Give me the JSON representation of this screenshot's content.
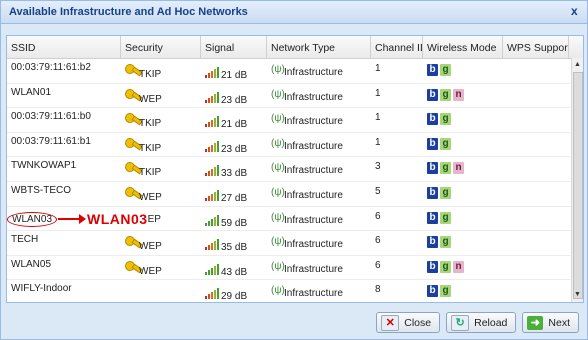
{
  "window": {
    "title": "Available Infrastructure and Ad Hoc Networks",
    "close_glyph": "x"
  },
  "columns": [
    "SSID",
    "Security",
    "Signal",
    "Network Type",
    "Channel ID",
    "Wireless Mode",
    "WPS Support"
  ],
  "rows": [
    {
      "ssid": "00:03:79:11:61:b2",
      "security": "TKIP",
      "signal": "21 dB",
      "type": "Infrastructure",
      "channel": "1",
      "modes": [
        "b",
        "g"
      ]
    },
    {
      "ssid": "WLAN01",
      "security": "WEP",
      "signal": "23 dB",
      "type": "Infrastructure",
      "channel": "1",
      "modes": [
        "b",
        "g",
        "n"
      ]
    },
    {
      "ssid": "00:03:79:11:61:b0",
      "security": "TKIP",
      "signal": "21 dB",
      "type": "Infrastructure",
      "channel": "1",
      "modes": [
        "b",
        "g"
      ]
    },
    {
      "ssid": "00:03:79:11:61:b1",
      "security": "TKIP",
      "signal": "23 dB",
      "type": "Infrastructure",
      "channel": "1",
      "modes": [
        "b",
        "g"
      ]
    },
    {
      "ssid": "TWNKOWAP1",
      "security": "TKIP",
      "signal": "33 dB",
      "type": "Infrastructure",
      "channel": "3",
      "modes": [
        "b",
        "g",
        "n"
      ]
    },
    {
      "ssid": "WBTS-TECO",
      "security": "WEP",
      "signal": "27 dB",
      "type": "Infrastructure",
      "channel": "5",
      "modes": [
        "b",
        "g"
      ]
    },
    {
      "ssid": "WLAN03",
      "security": "WEP",
      "signal": "59 dB",
      "type": "Infrastructure",
      "channel": "6",
      "modes": [
        "b",
        "g"
      ]
    },
    {
      "ssid": "TECH",
      "security": "WEP",
      "signal": "35 dB",
      "type": "Infrastructure",
      "channel": "6",
      "modes": [
        "b",
        "g"
      ]
    },
    {
      "ssid": "WLAN05",
      "security": "WEP",
      "signal": "43 dB",
      "type": "Infrastructure",
      "channel": "6",
      "modes": [
        "b",
        "g",
        "n"
      ]
    },
    {
      "ssid": "WIFLY-Indoor",
      "security": "",
      "signal": "29 dB",
      "type": "Infrastructure",
      "channel": "8",
      "modes": [
        "b",
        "g"
      ]
    }
  ],
  "annotation": {
    "circled": "WLAN03",
    "callout": "WLAN03",
    "security_fragment": "EP"
  },
  "buttons": {
    "close": "Close",
    "reload": "Reload",
    "next": "Next"
  }
}
